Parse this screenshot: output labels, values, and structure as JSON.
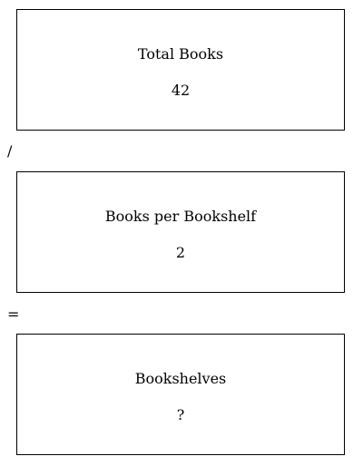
{
  "equation": {
    "dividend": {
      "label": "Total Books",
      "value": "42"
    },
    "divide_symbol": "/",
    "divisor": {
      "label": "Books per Bookshelf",
      "value": "2"
    },
    "equals_symbol": "=",
    "quotient": {
      "label": "Bookshelves",
      "value": "?"
    }
  }
}
